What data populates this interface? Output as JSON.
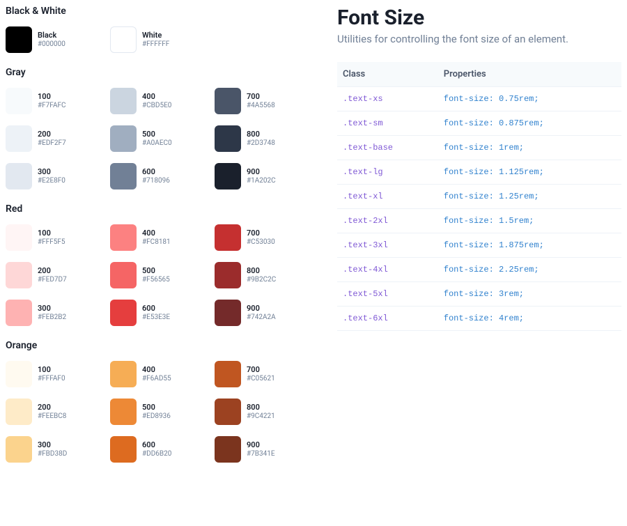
{
  "palette": {
    "sections": [
      {
        "title": "Black & White",
        "swatches": [
          {
            "name": "Black",
            "hex": "#000000",
            "bordered": false
          },
          {
            "name": "White",
            "hex": "#FFFFFF",
            "bordered": true
          }
        ]
      },
      {
        "title": "Gray",
        "swatches": [
          {
            "name": "100",
            "hex": "#F7FAFC",
            "bordered": false
          },
          {
            "name": "400",
            "hex": "#CBD5E0",
            "bordered": false
          },
          {
            "name": "700",
            "hex": "#4A5568",
            "bordered": false
          },
          {
            "name": "200",
            "hex": "#EDF2F7",
            "bordered": false
          },
          {
            "name": "500",
            "hex": "#A0AEC0",
            "bordered": false
          },
          {
            "name": "800",
            "hex": "#2D3748",
            "bordered": false
          },
          {
            "name": "300",
            "hex": "#E2E8F0",
            "bordered": false
          },
          {
            "name": "600",
            "hex": "#718096",
            "bordered": false
          },
          {
            "name": "900",
            "hex": "#1A202C",
            "bordered": false
          }
        ]
      },
      {
        "title": "Red",
        "swatches": [
          {
            "name": "100",
            "hex": "#FFF5F5",
            "bordered": false
          },
          {
            "name": "400",
            "hex": "#FC8181",
            "bordered": false
          },
          {
            "name": "700",
            "hex": "#C53030",
            "bordered": false
          },
          {
            "name": "200",
            "hex": "#FED7D7",
            "bordered": false
          },
          {
            "name": "500",
            "hex": "#F56565",
            "bordered": false
          },
          {
            "name": "800",
            "hex": "#9B2C2C",
            "bordered": false
          },
          {
            "name": "300",
            "hex": "#FEB2B2",
            "bordered": false
          },
          {
            "name": "600",
            "hex": "#E53E3E",
            "bordered": false
          },
          {
            "name": "900",
            "hex": "#742A2A",
            "bordered": false
          }
        ]
      },
      {
        "title": "Orange",
        "swatches": [
          {
            "name": "100",
            "hex": "#FFFAF0",
            "bordered": false
          },
          {
            "name": "400",
            "hex": "#F6AD55",
            "bordered": false
          },
          {
            "name": "700",
            "hex": "#C05621",
            "bordered": false
          },
          {
            "name": "200",
            "hex": "#FEEBC8",
            "bordered": false
          },
          {
            "name": "500",
            "hex": "#ED8936",
            "bordered": false
          },
          {
            "name": "800",
            "hex": "#9C4221",
            "bordered": false
          },
          {
            "name": "300",
            "hex": "#FBD38D",
            "bordered": false
          },
          {
            "name": "600",
            "hex": "#DD6B20",
            "bordered": false
          },
          {
            "name": "900",
            "hex": "#7B341E",
            "bordered": false
          }
        ]
      }
    ]
  },
  "fontsize": {
    "title": "Font Size",
    "subtitle": "Utilities for controlling the font size of an element.",
    "headers": {
      "class": "Class",
      "properties": "Properties"
    },
    "rows": [
      {
        "class": ".text-xs",
        "prop": "font-size: 0.75rem;"
      },
      {
        "class": ".text-sm",
        "prop": "font-size: 0.875rem;"
      },
      {
        "class": ".text-base",
        "prop": "font-size: 1rem;"
      },
      {
        "class": ".text-lg",
        "prop": "font-size: 1.125rem;"
      },
      {
        "class": ".text-xl",
        "prop": "font-size: 1.25rem;"
      },
      {
        "class": ".text-2xl",
        "prop": "font-size: 1.5rem;"
      },
      {
        "class": ".text-3xl",
        "prop": "font-size: 1.875rem;"
      },
      {
        "class": ".text-4xl",
        "prop": "font-size: 2.25rem;"
      },
      {
        "class": ".text-5xl",
        "prop": "font-size: 3rem;"
      },
      {
        "class": ".text-6xl",
        "prop": "font-size: 4rem;"
      }
    ]
  }
}
